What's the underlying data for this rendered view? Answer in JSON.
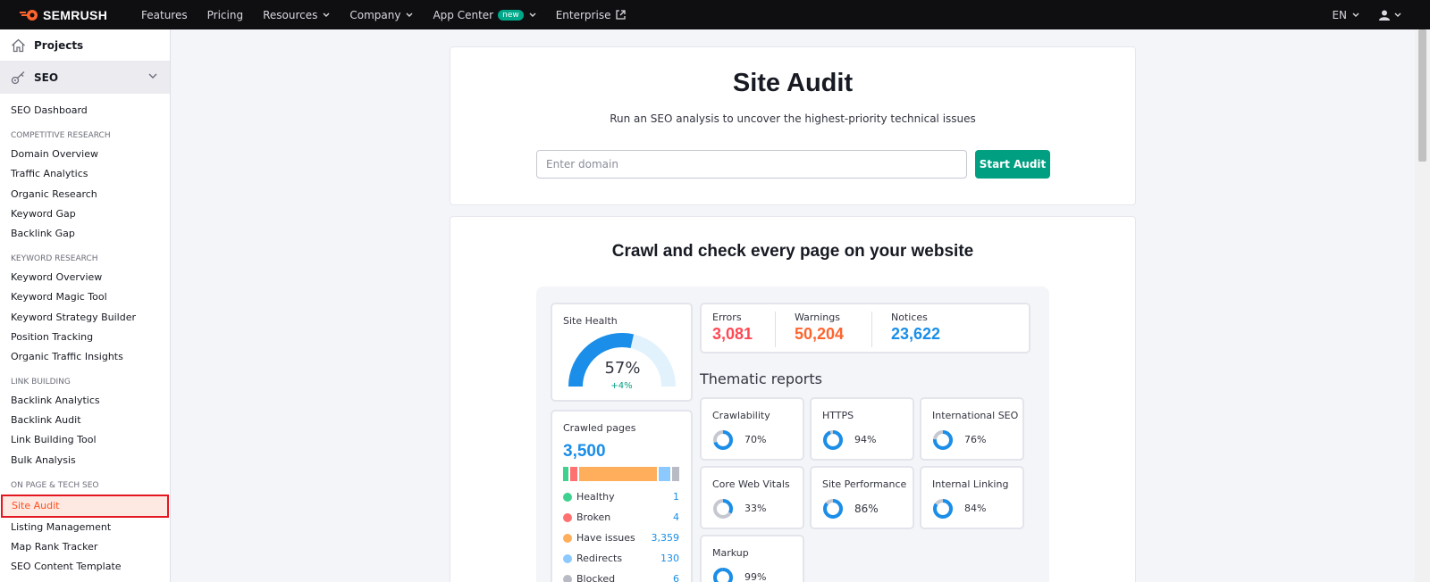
{
  "brand": {
    "name": "SEMRUSH",
    "accent": "#ff642d"
  },
  "topnav": {
    "items": [
      {
        "label": "Features",
        "has_dropdown": false
      },
      {
        "label": "Pricing",
        "has_dropdown": false
      },
      {
        "label": "Resources",
        "has_dropdown": true
      },
      {
        "label": "Company",
        "has_dropdown": true
      },
      {
        "label": "App Center",
        "badge": "new",
        "has_dropdown": true
      },
      {
        "label": "Enterprise",
        "external": true
      }
    ],
    "language": "EN"
  },
  "sidebar": {
    "projects_label": "Projects",
    "seo_label": "SEO",
    "dashboard_label": "SEO Dashboard",
    "sections": [
      {
        "title": "COMPETITIVE RESEARCH",
        "items": [
          "Domain Overview",
          "Traffic Analytics",
          "Organic Research",
          "Keyword Gap",
          "Backlink Gap"
        ]
      },
      {
        "title": "KEYWORD RESEARCH",
        "items": [
          "Keyword Overview",
          "Keyword Magic Tool",
          "Keyword Strategy Builder",
          "Position Tracking",
          "Organic Traffic Insights"
        ]
      },
      {
        "title": "LINK BUILDING",
        "items": [
          "Backlink Analytics",
          "Backlink Audit",
          "Link Building Tool",
          "Bulk Analysis"
        ]
      },
      {
        "title": "ON PAGE & TECH SEO",
        "items": [
          "Site Audit",
          "Listing Management",
          "Map Rank Tracker",
          "SEO Content Template"
        ],
        "active": "Site Audit"
      }
    ]
  },
  "hero": {
    "title": "Site Audit",
    "subtitle": "Run an SEO analysis to uncover the highest-priority technical issues",
    "input_placeholder": "Enter domain",
    "button_label": "Start Audit"
  },
  "preview": {
    "title": "Crawl and check every page on your website",
    "site_health": {
      "label": "Site Health",
      "value": "57%",
      "fraction": 0.57,
      "delta": "+4%"
    },
    "issues": [
      {
        "label": "Errors",
        "value": "3,081",
        "color": "#ff4953"
      },
      {
        "label": "Warnings",
        "value": "50,204",
        "color": "#ff642d"
      },
      {
        "label": "Notices",
        "value": "23,622",
        "color": "#1a8ee8"
      }
    ],
    "thematic_title": "Thematic reports",
    "reports": [
      {
        "label": "Crawlability",
        "value": "70%",
        "fraction": 0.7
      },
      {
        "label": "HTTPS",
        "value": "94%",
        "fraction": 0.94
      },
      {
        "label": "International SEO",
        "value": "76%",
        "fraction": 0.76
      },
      {
        "label": "Core Web Vitals",
        "value": "33%",
        "fraction": 0.33
      },
      {
        "label": "Site Performance",
        "value": "86%",
        "fraction": 0.86
      },
      {
        "label": "Internal Linking",
        "value": "84%",
        "fraction": 0.84
      },
      {
        "label": "Markup",
        "value": "99%",
        "fraction": 0.99
      }
    ],
    "crawled": {
      "label": "Crawled pages",
      "total": "3,500",
      "rows": [
        {
          "label": "Healthy",
          "count": "1",
          "color": "#3fd18f",
          "share": 0.05
        },
        {
          "label": "Broken",
          "count": "4",
          "color": "#ff7070",
          "share": 0.06
        },
        {
          "label": "Have issues",
          "count": "3,359",
          "color": "#ffae5c",
          "share": 0.67
        },
        {
          "label": "Redirects",
          "count": "130",
          "color": "#8cc9ff",
          "share": 0.1
        },
        {
          "label": "Blocked",
          "count": "6",
          "color": "#b9bbc4",
          "share": 0.06
        }
      ]
    }
  }
}
